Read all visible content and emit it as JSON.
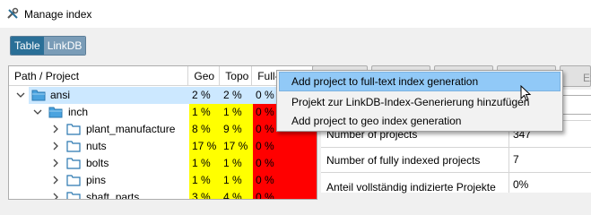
{
  "window": {
    "title": "Manage index",
    "icon": "tools-icon"
  },
  "view_toggle": {
    "items": [
      {
        "label": "Table",
        "active": true
      },
      {
        "label": "LinkDB",
        "active": false
      }
    ]
  },
  "tree": {
    "headers": {
      "path": "Path / Project",
      "geo": "Geo",
      "topo": "Topo",
      "full": "Full-"
    },
    "rows": [
      {
        "label": "ansi",
        "geo": "2 %",
        "topo": "2 %",
        "full": "0 %",
        "level": 0,
        "expanded": true,
        "selected": true
      },
      {
        "label": "inch",
        "geo": "1 %",
        "topo": "1 %",
        "full": "0 %",
        "level": 1,
        "expanded": true,
        "selected": false
      },
      {
        "label": "plant_manufacture",
        "geo": "8 %",
        "topo": "9 %",
        "full": "0 %",
        "level": 2,
        "expanded": false,
        "selected": false
      },
      {
        "label": "nuts",
        "geo": "17 %",
        "topo": "17 %",
        "full": "0 %",
        "level": 2,
        "expanded": false,
        "selected": false
      },
      {
        "label": "bolts",
        "geo": "1 %",
        "topo": "1 %",
        "full": "0 %",
        "level": 2,
        "expanded": false,
        "selected": false
      },
      {
        "label": "pins",
        "geo": "1 %",
        "topo": "1 %",
        "full": "0 %",
        "level": 2,
        "expanded": false,
        "selected": false
      },
      {
        "label": "shaft_parts",
        "geo": "3 %",
        "topo": "4 %",
        "full": "0 %",
        "level": 2,
        "expanded": false,
        "selected": false
      }
    ]
  },
  "context_menu": {
    "items": [
      {
        "label": "Add project to full-text index generation",
        "highlighted": true
      },
      {
        "label": "Projekt zur LinkDB-Index-Generierung hinzufügen",
        "highlighted": false
      },
      {
        "label": "Add project to geo index generation",
        "highlighted": false
      }
    ]
  },
  "right_panel": {
    "tab_partial_label": "Ex",
    "combo_value": "k(Geo)",
    "rows": [
      {
        "label": "Number of projects",
        "value": "347"
      },
      {
        "label": "Number of fully indexed projects",
        "value": "7"
      },
      {
        "label": "Anteil vollständig indizierte Projekte",
        "value": "0%"
      }
    ]
  },
  "colors": {
    "low": "#ffff00",
    "zero": "#ff0000",
    "selection": "#cce8ff",
    "menu_highlight": "#91c9f7",
    "toggle_active": "#2a6f97",
    "folder": "#4aa3df"
  }
}
